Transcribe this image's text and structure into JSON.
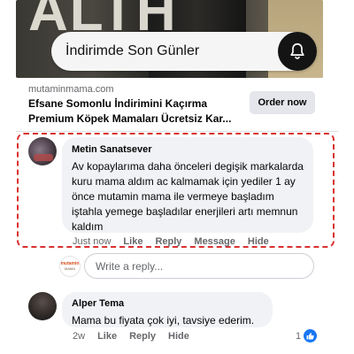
{
  "ad": {
    "banner_brand": "ALTH",
    "promo_text": "İndirimde Son Günler",
    "domain": "mutaminmama.com",
    "title": "Efsane Somonlu İndirimini Kaçırma Premium Köpek Mamaları Ücretsiz Kar...",
    "cta_label": "Order now"
  },
  "comments": [
    {
      "author": "Metin Sanatsever",
      "text": "Av kopaylarıma daha önceleri degişik markalarda kuru mama aldım ac kalmamak için yediler  1 ay önce mutamin mama ile vermeye başladım iştahla yemege başladılar enerjileri artı memnun kaldım",
      "time": "Just now",
      "actions": {
        "like": "Like",
        "reply": "Reply",
        "message": "Message",
        "hide": "Hide"
      }
    },
    {
      "author": "Alper Tema",
      "text": "Mama bu fiyata çok iyi, tavsiye ederim.",
      "time": "2w",
      "actions": {
        "like": "Like",
        "reply": "Reply",
        "hide": "Hide"
      },
      "like_count": "1"
    }
  ],
  "reply_box": {
    "placeholder": "Write a reply...",
    "avatar_logo_top": "mutamin",
    "avatar_logo_bottom": "MAMA"
  },
  "colors": {
    "highlight_border": "#d93131",
    "bubble_bg": "#f0f2f5",
    "like_badge": "#1877f2",
    "secondary_text": "#65676b"
  }
}
